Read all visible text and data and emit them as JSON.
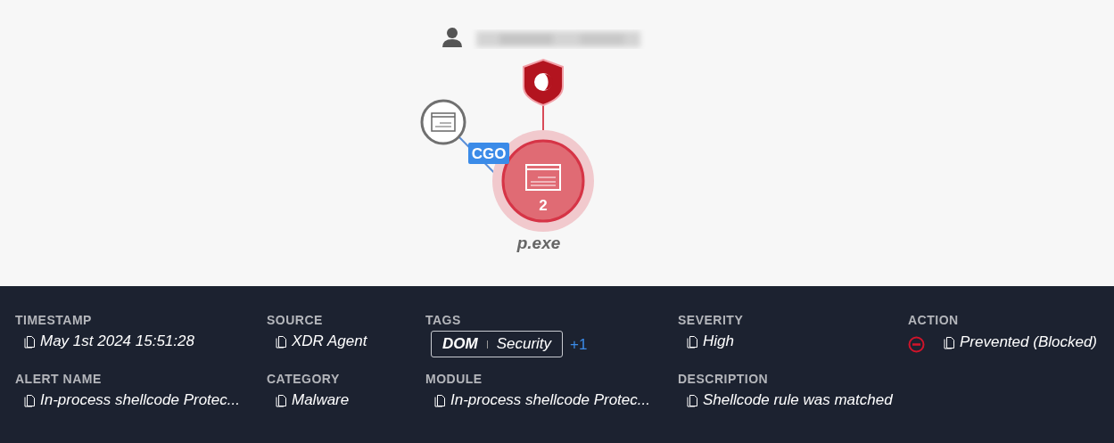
{
  "graph": {
    "edge_label": "CGO",
    "process": {
      "name": "p.exe",
      "count": "2"
    }
  },
  "details": [
    {
      "label": "TIMESTAMP",
      "kind": "text",
      "value": "May 1st 2024 15:51:28"
    },
    {
      "label": "SOURCE",
      "kind": "text",
      "value": "XDR Agent"
    },
    {
      "label": "TAGS",
      "kind": "tags",
      "tags": [
        {
          "label": "DOM",
          "strong": true
        },
        {
          "label": "Security",
          "strong": false
        }
      ],
      "more": "+1"
    },
    {
      "label": "SEVERITY",
      "kind": "text",
      "value": "High"
    },
    {
      "label": "ACTION",
      "kind": "action",
      "value": "Prevented (Blocked)"
    },
    {
      "label": "ALERT NAME",
      "kind": "text",
      "value": "In-process shellcode Protec..."
    },
    {
      "label": "CATEGORY",
      "kind": "text",
      "value": "Malware"
    },
    {
      "label": "MODULE",
      "kind": "text",
      "value": "In-process shellcode Protec..."
    },
    {
      "label": "DESCRIPTION",
      "kind": "text",
      "value": "Shellcode rule was matched"
    }
  ]
}
